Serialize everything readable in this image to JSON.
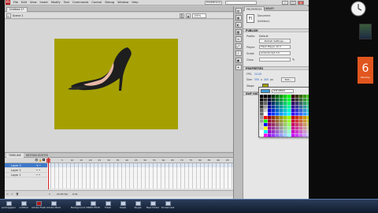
{
  "app": {
    "logo": "Fl",
    "menu": [
      "File",
      "Edit",
      "View",
      "Insert",
      "Modify",
      "Text",
      "Commands",
      "Control",
      "Debug",
      "Window",
      "Help"
    ],
    "workspace": "ESSENTIALS",
    "search_placeholder": "",
    "window_buttons": [
      "–",
      "□",
      "×"
    ]
  },
  "document": {
    "tab": "Untitled-1*",
    "scene": "Scene 1",
    "zoom": "100%",
    "stage_color": "#a5a000"
  },
  "timeline": {
    "tabs": [
      "TIMELINE",
      "MOTION EDITOR"
    ],
    "frame_numbers": [
      "5",
      "10",
      "15",
      "20",
      "25",
      "30",
      "35",
      "40",
      "45",
      "50",
      "55",
      "60",
      "65",
      "70",
      "75",
      "80",
      "85",
      "90",
      "95"
    ],
    "layers": [
      {
        "name": "Layer 3",
        "selected": true
      },
      {
        "name": "Layer 2",
        "selected": false
      },
      {
        "name": "Layer 1",
        "selected": false
      }
    ],
    "status": {
      "frame": "1",
      "fps": "24.00 fps",
      "time": "0.0s"
    }
  },
  "properties": {
    "tabs": [
      "PROPERTIES",
      "LIBRARY"
    ],
    "doc_icon_label": "Fl",
    "doc_type": "Document",
    "doc_name": "Untitled-1",
    "sections": {
      "publish": "PUBLISH",
      "properties": "PROPERTIES",
      "swf_history": "SWF HISTORY"
    },
    "publish_rows": [
      {
        "label": "Profile:",
        "value": "Default"
      },
      {
        "label": "Player:",
        "value": "Flash Player 10.3"
      },
      {
        "label": "Script:",
        "value": "ActionScript 3.0"
      },
      {
        "label": "Class:",
        "value": ""
      }
    ],
    "publish_button": "Publish Settings...",
    "fps_label": "FPS:",
    "fps_value": "24.00",
    "size_label": "Size:",
    "size_w": "550",
    "size_x": "x",
    "size_h": "400",
    "size_unit": "px",
    "edit_button": "Edit...",
    "stage_label": "Stage:"
  },
  "swatch": {
    "hex": "#3D9BD9",
    "preview_color": "#3d9bd9"
  },
  "desktop": {
    "calendar_day": "6",
    "calendar_month": "Monday"
  },
  "taskbar": {
    "items": [
      {
        "label": "packagejson"
      },
      {
        "label": "untitled"
      },
      {
        "label": "Adobe Flash"
      },
      {
        "label": "Adobe Media"
      },
      {
        "label": "BackgroundCol"
      },
      {
        "label": "VIDEO ESTUDIO"
      },
      {
        "label": "Flash"
      },
      {
        "label": "heels"
      },
      {
        "label": "Skype"
      },
      {
        "label": "New folder"
      },
      {
        "label": "Screencast"
      }
    ],
    "tray_time": "",
    "tray_date": ""
  }
}
